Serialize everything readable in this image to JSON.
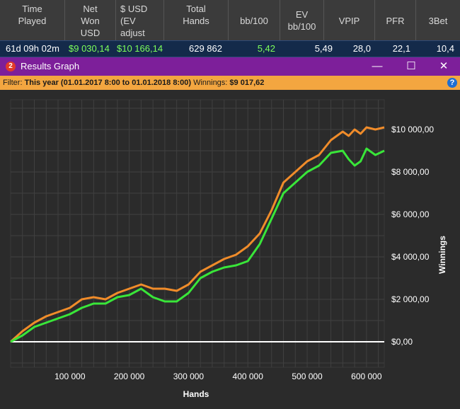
{
  "stats": {
    "headers": [
      [
        "Time",
        "Played"
      ],
      [
        "Net",
        "Won",
        "USD"
      ],
      [
        "$ USD",
        "(EV",
        "adjust"
      ],
      [
        "Total",
        "Hands"
      ],
      [
        "bb/100"
      ],
      [
        "EV",
        "bb/100"
      ],
      [
        "VPIP"
      ],
      [
        "PFR"
      ],
      [
        "3Bet"
      ]
    ],
    "values": [
      "61d 09h 02m",
      "$9 030,14",
      "$10 166,14",
      "629 862",
      "5,42",
      "5,49",
      "28,0",
      "22,1",
      "10,4"
    ],
    "colors": {
      "positive": "#7dff5a",
      "text": "#ffffff",
      "row_bg": "#142a4a"
    }
  },
  "window": {
    "badge": "2",
    "title": "Results Graph",
    "minimize": "—",
    "maximize": "☐",
    "close": "✕"
  },
  "filter": {
    "label": "Filter:",
    "value": "This year (01.01.2017 8:00 to 01.01.2018 8:00)",
    "winnings_label": "Winnings:",
    "winnings_value": "$9 017,62",
    "help": "?"
  },
  "chart_data": {
    "type": "line",
    "xlabel": "Hands",
    "ylabel": "Winnings",
    "xlim": [
      0,
      630000
    ],
    "ylim": [
      -1200,
      11400
    ],
    "x_ticks": [
      100000,
      200000,
      300000,
      400000,
      500000,
      600000
    ],
    "x_tick_labels": [
      "100 000",
      "200 000",
      "300 000",
      "400 000",
      "500 000",
      "600 000"
    ],
    "y_ticks": [
      0,
      2000,
      4000,
      6000,
      8000,
      10000
    ],
    "y_tick_labels": [
      "$0,00",
      "$2 000,00",
      "$4 000,00",
      "$6 000,00",
      "$8 000,00",
      "$10 000,00"
    ],
    "grid": true,
    "colors": {
      "background": "#2b2b2b",
      "grid": "#404040",
      "zero": "#ffffff",
      "ev": "#f08c2a",
      "net": "#39e639",
      "text": "#ffffff"
    },
    "series": [
      {
        "color": "#f08c2a",
        "x": [
          0,
          20000,
          40000,
          60000,
          80000,
          100000,
          120000,
          140000,
          160000,
          180000,
          200000,
          220000,
          240000,
          260000,
          280000,
          300000,
          320000,
          340000,
          360000,
          380000,
          400000,
          420000,
          440000,
          460000,
          480000,
          500000,
          520000,
          540000,
          560000,
          570000,
          580000,
          590000,
          600000,
          615000,
          630000
        ],
        "y": [
          0,
          500,
          900,
          1200,
          1400,
          1600,
          2000,
          2100,
          2000,
          2300,
          2500,
          2700,
          2500,
          2500,
          2400,
          2700,
          3300,
          3600,
          3900,
          4100,
          4500,
          5100,
          6200,
          7500,
          8000,
          8500,
          8800,
          9500,
          9900,
          9700,
          10000,
          9800,
          10100,
          10000,
          10100
        ]
      },
      {
        "color": "#39e639",
        "x": [
          0,
          20000,
          40000,
          60000,
          80000,
          100000,
          120000,
          140000,
          160000,
          180000,
          200000,
          220000,
          240000,
          260000,
          280000,
          300000,
          320000,
          340000,
          360000,
          380000,
          400000,
          420000,
          440000,
          460000,
          480000,
          500000,
          520000,
          540000,
          560000,
          570000,
          580000,
          590000,
          600000,
          615000,
          630000
        ],
        "y": [
          0,
          300,
          700,
          900,
          1100,
          1300,
          1600,
          1800,
          1800,
          2100,
          2200,
          2500,
          2100,
          1900,
          1900,
          2300,
          3000,
          3300,
          3500,
          3600,
          3800,
          4600,
          5800,
          7000,
          7500,
          8000,
          8300,
          8900,
          9000,
          8600,
          8300,
          8500,
          9100,
          8800,
          9000
        ]
      }
    ]
  }
}
